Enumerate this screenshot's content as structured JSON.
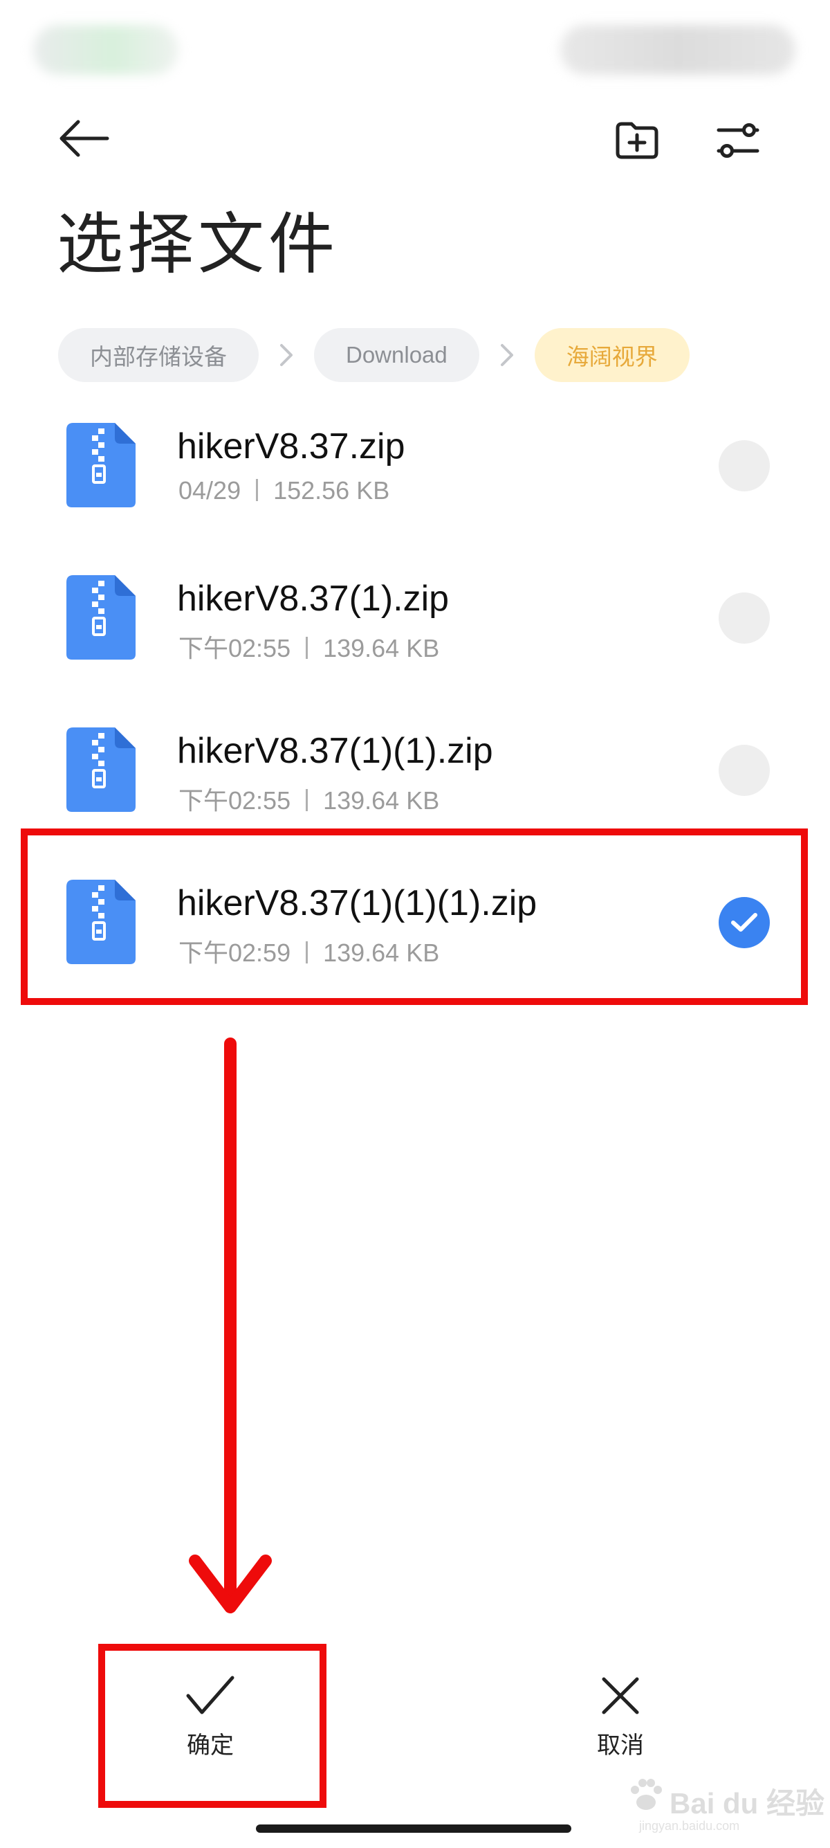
{
  "header": {
    "title": "选择文件",
    "icons": {
      "back": "arrow-left-icon",
      "new_folder": "folder-plus-icon",
      "filter": "sliders-icon"
    }
  },
  "breadcrumb": [
    "内部存储设备",
    "Download",
    "海阔视界"
  ],
  "files": [
    {
      "name": "hikerV8.37.zip",
      "date": "04/29",
      "size": "152.56 KB",
      "selected": false
    },
    {
      "name": "hikerV8.37(1).zip",
      "date": "下午02:55",
      "size": "139.64 KB",
      "selected": false
    },
    {
      "name": "hikerV8.37(1)(1).zip",
      "date": "下午02:55",
      "size": "139.64 KB",
      "selected": false
    },
    {
      "name": "hikerV8.37(1)(1)(1).zip",
      "date": "下午02:59",
      "size": "139.64 KB",
      "selected": true
    }
  ],
  "bottom": {
    "confirm_label": "确定",
    "cancel_label": "取消"
  },
  "watermark": {
    "logo": "Bai du 经验",
    "url": "jingyan.baidu.com"
  },
  "colors": {
    "accent": "#3a83f1",
    "zip_icon": "#4a8ff5",
    "annotation": "#ee0b0b",
    "breadcrumb_active_bg": "#fff2cc",
    "breadcrumb_active_text": "#e7a93a"
  }
}
